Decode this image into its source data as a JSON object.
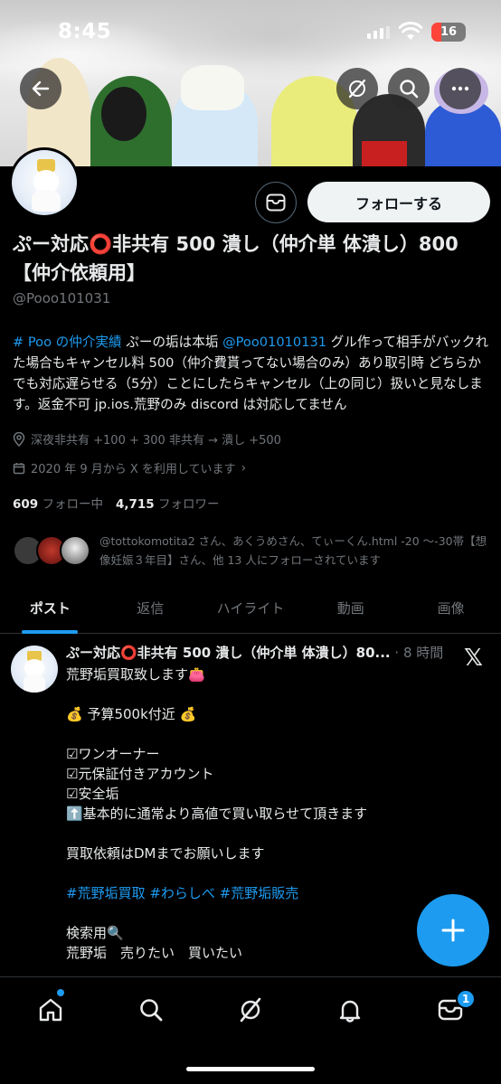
{
  "status_bar": {
    "time": "8:45",
    "battery": "16"
  },
  "header": {
    "back_icon": "back-arrow-icon",
    "grok_icon": "slash-circle-icon",
    "search_icon": "search-icon",
    "more_icon": "more-dots-icon"
  },
  "profile": {
    "follow_label": "フォローする",
    "name": "ぷー対応⭕非共有 500 潰し（仲介単 体潰し）800【仲介依頼用】",
    "handle": "@Pooo101031",
    "bio": {
      "hashtag": "# Poo の仲介実績",
      "part1": " ぷーの垢は本垢 ",
      "mention": "@Poo01010131",
      "part2": " グル作って相手がバックれた場合もキャンセル料 500（仲介費貰ってない場合のみ）あり取引時 どちらかでも対応遅らせる（5分）ことにしたらキャンセル（上の同じ）扱いと見なします。返金不可 jp.ios.荒野のみ discord は対応してません"
    },
    "location": "深夜非共有 +100 + 300 非共有 → 潰し +500",
    "joined": "2020 年 9 月から X を利用しています",
    "following_count": "609",
    "following_label": "フォロー中",
    "followers_count": "4,715",
    "followers_label": "フォロワー",
    "followed_by": "@tottokomotita2 さん、あくうめさん、てぃーくん.html -20 〜-30帯【想像妊娠３年目】さん、他 13 人にフォローされています"
  },
  "tabs": [
    {
      "label": "ポスト"
    },
    {
      "label": "返信"
    },
    {
      "label": "ハイライト"
    },
    {
      "label": "動画"
    },
    {
      "label": "画像"
    }
  ],
  "post": {
    "author": "ぷー対応⭕非共有 500 潰し（仲介単 体潰し）80...",
    "time": "· 8 時間",
    "lines": [
      "荒野垢買取致します👛",
      "",
      "💰 予算500k付近 💰",
      "",
      "☑ワンオーナー",
      "☑元保証付きアカウント",
      "☑安全垢",
      "⬆️基本的に通常より高値で買い取らせて頂きます",
      "",
      "買取依頼はDMまでお願いします",
      "",
      "",
      "",
      "検索用🔍",
      "荒野垢　売りたい　買いたい"
    ],
    "hashtags": "#荒野垢買取 #わらしべ #荒野垢販売"
  },
  "bottom_nav": {
    "items": [
      "home-icon",
      "search-icon",
      "grok-icon",
      "bell-icon",
      "mail-icon"
    ],
    "mail_badge": "1"
  }
}
